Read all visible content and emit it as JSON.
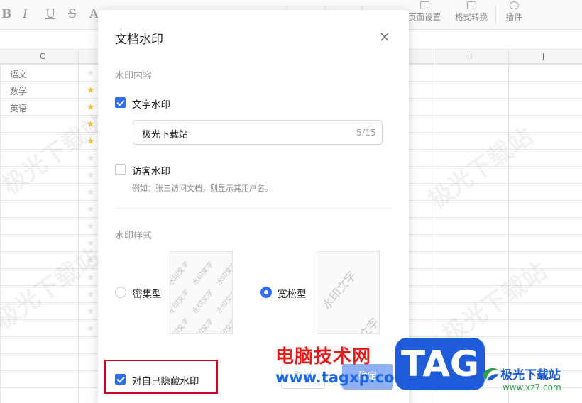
{
  "toolbar": {
    "format_buttons": [
      "B",
      "I",
      "U",
      "S",
      "A"
    ],
    "items": [
      "页面设置",
      "格式转换",
      "插件"
    ]
  },
  "sheet": {
    "columns": [
      "C",
      "I",
      "J"
    ],
    "rows": [
      {
        "text": "语文",
        "starred": false
      },
      {
        "text": "数学",
        "starred": true
      },
      {
        "text": "英语",
        "starred": true
      },
      {
        "text": "",
        "starred": true
      },
      {
        "text": "",
        "starred": true
      }
    ],
    "background_watermark": "极光下载站"
  },
  "dialog": {
    "title": "文档水印",
    "section_content": "水印内容",
    "text_watermark": {
      "label": "文字水印",
      "checked": true,
      "value": "极光下载站",
      "count": "5/15"
    },
    "visitor_watermark": {
      "label": "访客水印",
      "checked": false,
      "hint": "例如：张三访问文档，则显示其用户名。"
    },
    "section_style": "水印样式",
    "styles": [
      {
        "label": "密集型",
        "selected": false,
        "preview_text": "水印文字"
      },
      {
        "label": "宽松型",
        "selected": true,
        "preview_text": "水印文字"
      }
    ],
    "hide_for_self": {
      "label": "对自己隐藏水印",
      "checked": true
    },
    "cancel_label": "取消",
    "confirm_label": "确定"
  },
  "overlay": {
    "site_cn": "电脑技术网",
    "site_url": "www.tagxp.com",
    "tag": "TAG",
    "brand_name": "极光下载站",
    "brand_url": "www.xz7.com"
  },
  "colors": {
    "accent": "#2e6ef2",
    "highlight": "#d0021b",
    "star": "#f3c43a"
  }
}
